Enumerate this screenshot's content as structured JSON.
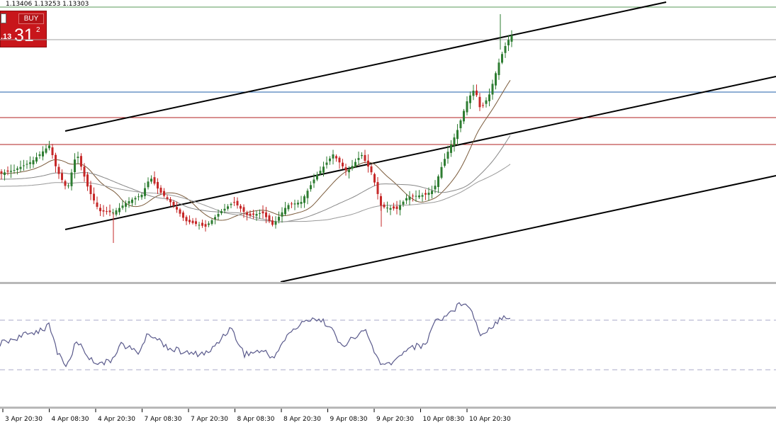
{
  "header": {
    "ohlc_text": "1.13406 1.13253 1.13303"
  },
  "trade_panel": {
    "buy_label": "BUY",
    "price_prefix": ".13",
    "price_big": "31",
    "price_sup": "2"
  },
  "colors": {
    "candle_up": "#2e7d32",
    "candle_down": "#c62828",
    "blue_level": "#1f5fa8",
    "red_level": "#b22222",
    "green_level": "#5a9a5a",
    "gray_level": "#a0a0a0",
    "rsi_line": "#5a5a8c",
    "channel": "#000000",
    "buy_panel": "#c8161b"
  },
  "chart_data": {
    "type": "candlestick",
    "title": "",
    "x_tick_labels": [
      "3 Apr 20:30",
      "4 Apr 08:30",
      "4 Apr 20:30",
      "7 Apr 08:30",
      "7 Apr 20:30",
      "8 Apr 08:30",
      "8 Apr 20:30",
      "9 Apr 08:30",
      "9 Apr 20:30",
      "10 Apr 08:30",
      "10 Apr 20:30"
    ],
    "horizontal_levels": [
      {
        "color": "green",
        "style": "solid"
      },
      {
        "color": "gray",
        "style": "solid"
      },
      {
        "color": "blue",
        "style": "solid"
      },
      {
        "color": "red",
        "style": "solid"
      },
      {
        "color": "red",
        "style": "solid"
      }
    ],
    "moving_averages_count": 3,
    "trend_channel_lines": 3,
    "lower_indicator": {
      "type": "line",
      "dashed_levels": 2
    },
    "grid": false
  }
}
